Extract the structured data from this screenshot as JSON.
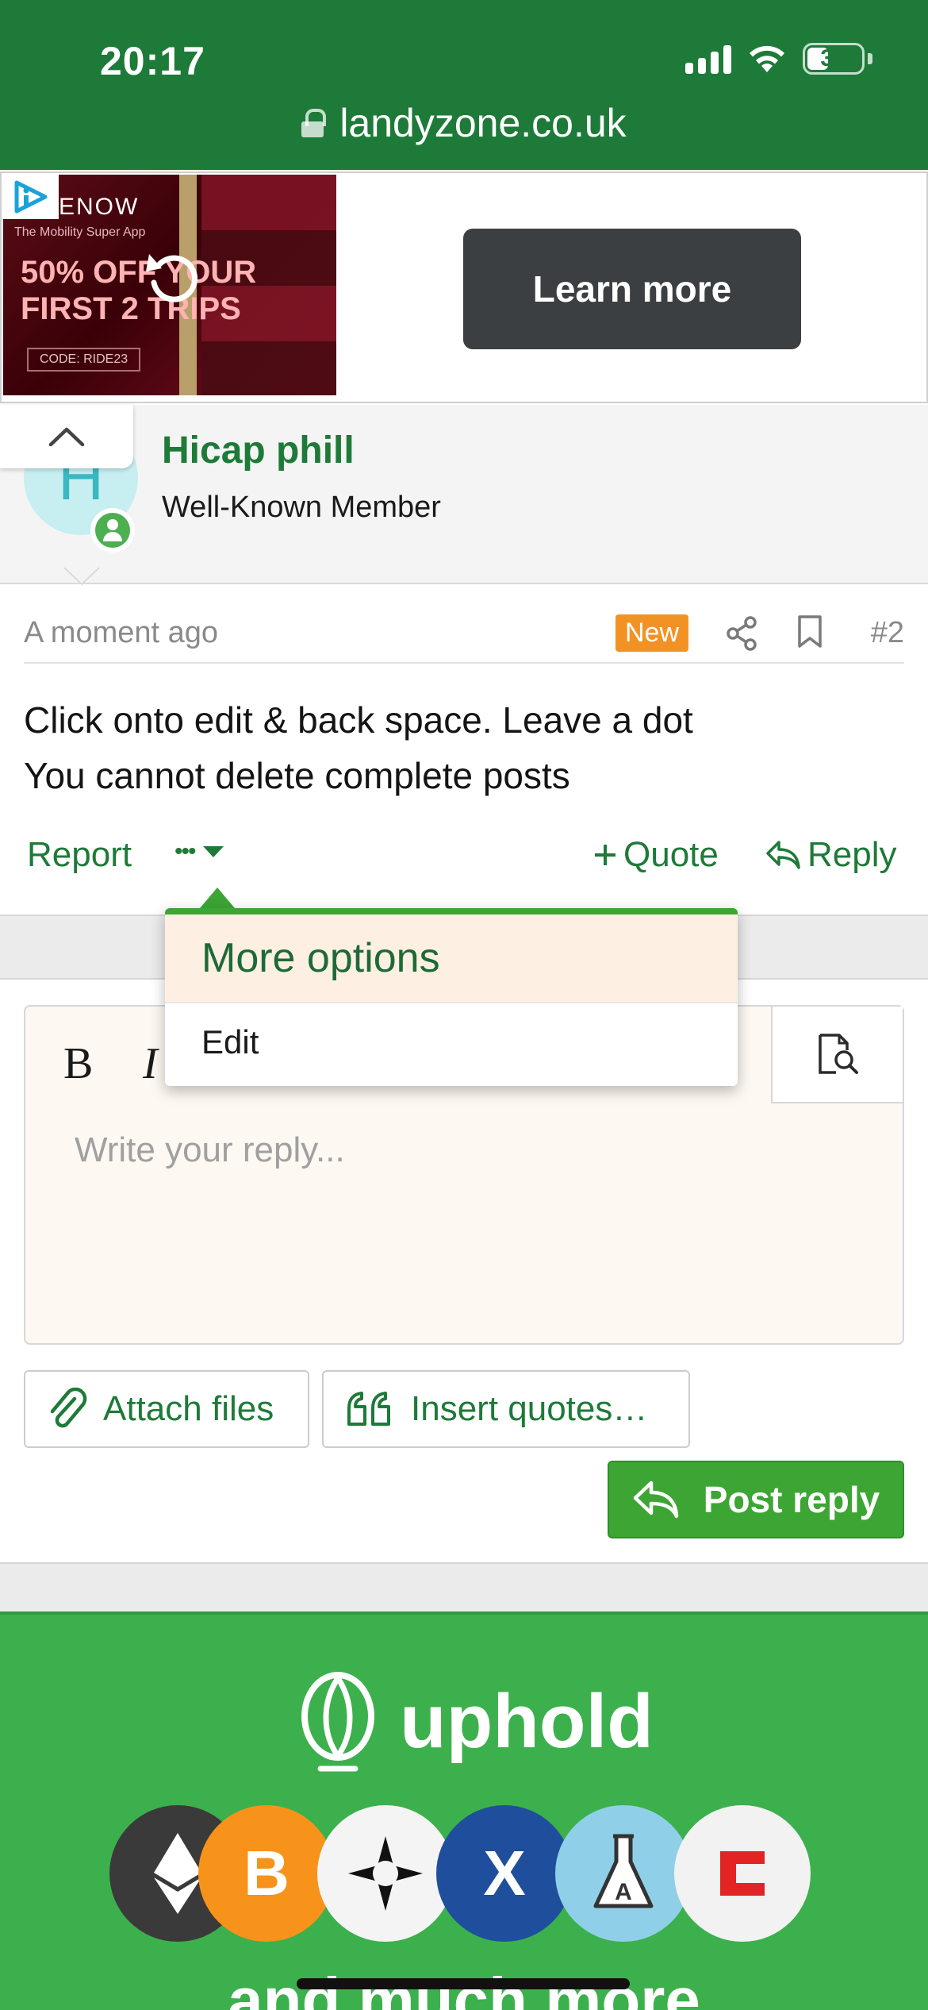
{
  "status_bar": {
    "time": "20:17",
    "battery": "37"
  },
  "browser": {
    "url": "landyzone.co.uk"
  },
  "ad_top": {
    "brand": "ENOW",
    "tagline": "The Mobility Super App",
    "offer_line1": "50% OFF YOUR",
    "offer_line2": "FIRST 2 TRIPS",
    "code": "CODE: RIDE23",
    "cta": "Learn more"
  },
  "member": {
    "avatar_letter": "H",
    "name": "Hicap phill",
    "title": "Well-Known Member"
  },
  "post": {
    "time": "A moment ago",
    "badge": "New",
    "number": "#2",
    "body_line1": "Click onto edit & back space. Leave a dot",
    "body_line2": "You cannot delete complete posts",
    "actions": {
      "report": "Report",
      "more": "•••",
      "quote": "Quote",
      "reply": "Reply"
    }
  },
  "menu": {
    "header": "More options",
    "items": [
      {
        "label": "Edit"
      }
    ]
  },
  "editor": {
    "bold": "B",
    "italic": "I",
    "placeholder": "Write your reply..."
  },
  "buttons": {
    "attach": "Attach files",
    "quotes": "Insert quotes…",
    "post_reply": "Post reply"
  },
  "ad_bottom": {
    "brand": "uphold",
    "tagline": "and much more"
  },
  "colors": {
    "primary": "#1e7a38",
    "accent": "#3da534",
    "badge": "#f39224"
  }
}
